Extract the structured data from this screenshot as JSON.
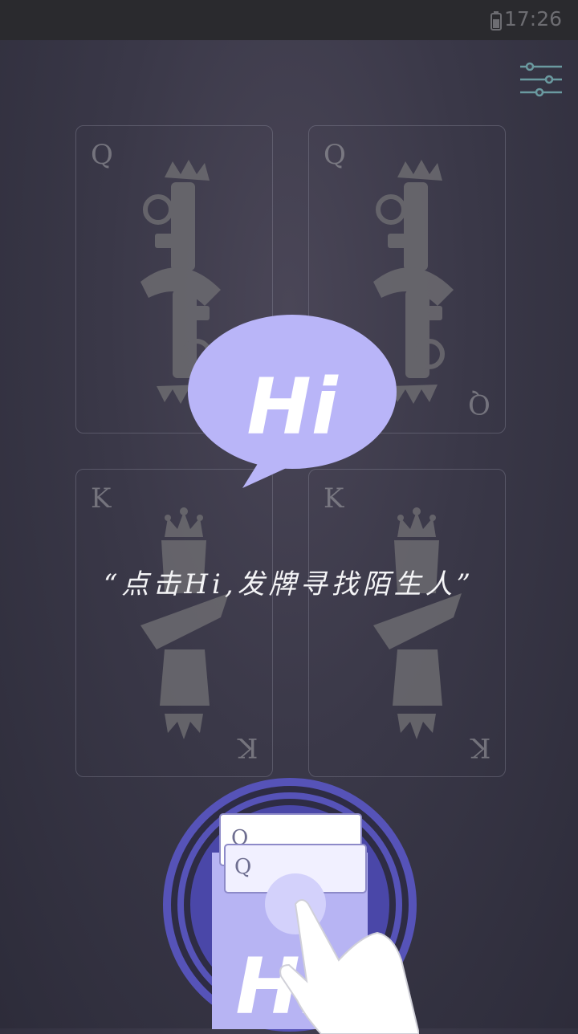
{
  "status_bar": {
    "time": "17:26",
    "battery_icon": "battery-icon"
  },
  "toolbar": {
    "settings_icon": "sliders-icon"
  },
  "cards": [
    {
      "rank": "Q"
    },
    {
      "rank": "Q"
    },
    {
      "rank": "K"
    },
    {
      "rank": "K"
    }
  ],
  "bubble": {
    "text": "Hi"
  },
  "instruction": {
    "text": "“点击Hi,发牌寻找陌生人”"
  },
  "hi_button": {
    "mini_cards": [
      "Q",
      "Q"
    ],
    "label": "Hi"
  },
  "colors": {
    "accent": "#b9b5f8",
    "ring": "#5653b8",
    "background": "#3a3848"
  }
}
